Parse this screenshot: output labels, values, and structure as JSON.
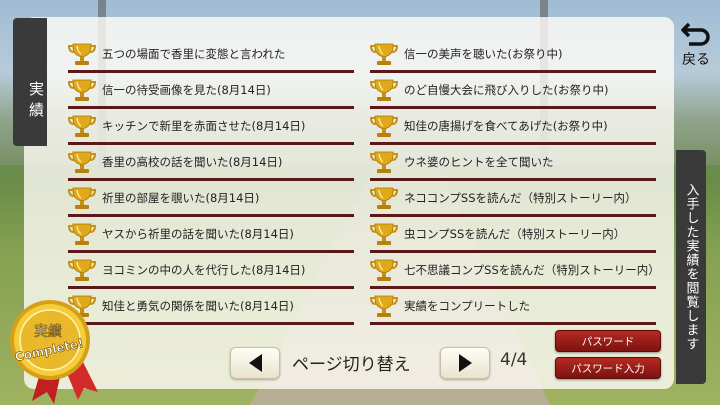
{
  "tabs": {
    "left_title": "実績",
    "right_title": "入手した実績を閲覧します"
  },
  "back_button": {
    "label": "戻る"
  },
  "achievements_left": [
    "五つの場面で香里に変態と言われた",
    "信一の待受画像を見た(8月14日)",
    "キッチンで新里を赤面させた(8月14日)",
    "香里の高校の話を聞いた(8月14日)",
    "祈里の部屋を覗いた(8月14日)",
    "ヤスから祈里の話を聞いた(8月14日)",
    "ヨコミンの中の人を代行した(8月14日)",
    "知佳と勇気の関係を聞いた(8月14日)"
  ],
  "achievements_right": [
    "信一の美声を聴いた(お祭り中)",
    "のど自慢大会に飛び入りした(お祭り中)",
    "知佳の唐揚げを食べてあげた(お祭り中)",
    "ウネ婆のヒントを全て聞いた",
    "ネココンプSSを読んだ（特別ストーリー内）",
    "虫コンプSSを読んだ（特別ストーリー内）",
    "七不思議コンプSSを読んだ（特別ストーリー内）",
    "実績をコンプリートした"
  ],
  "pagination": {
    "label": "ページ切り替え",
    "page": "4/4"
  },
  "buttons": {
    "password": "パスワード",
    "password_input": "パスワード入力"
  },
  "medal": {
    "top_text": "実績",
    "bottom_text": "Complete!"
  },
  "colors": {
    "trophy": "#d9a21b",
    "rule": "#5a1818",
    "red_button": "#9a1e18",
    "tab": "#3a3a3a"
  }
}
